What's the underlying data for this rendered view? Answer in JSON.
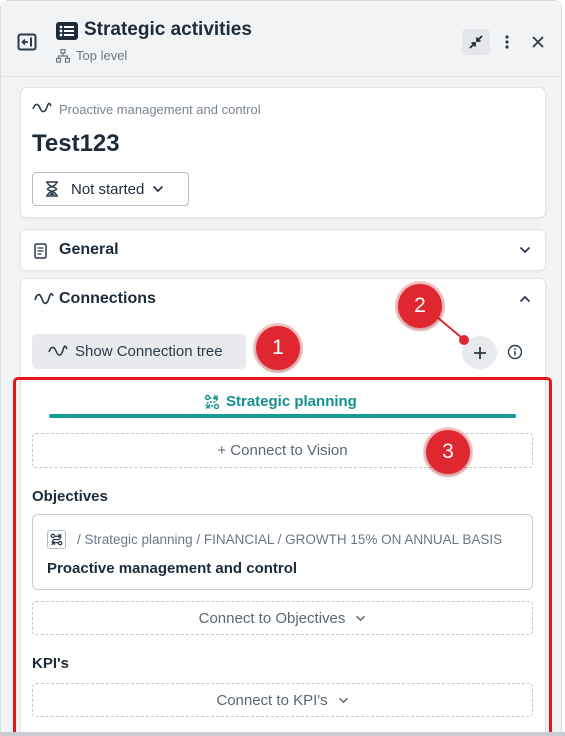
{
  "header": {
    "title": "Strategic activities",
    "subtitle": "Top level",
    "icons": [
      "collapse-panel-icon",
      "list-icon",
      "hierarchy-icon",
      "minimize-icon",
      "more-vertical-icon",
      "close-icon"
    ]
  },
  "item": {
    "breadcrumb": "Proactive management and control",
    "title": "Test123",
    "status": "Not started"
  },
  "sections": {
    "general": {
      "label": "General"
    },
    "connections": {
      "label": "Connections",
      "show_tree_label": "Show Connection tree",
      "strategic_planning_label": "Strategic planning",
      "connect_vision_label": "+ Connect to Vision",
      "objectives_heading": "Objectives",
      "objective": {
        "path": "/ Strategic planning / FINANCIAL / GROWTH 15% ON ANNUAL BASIS",
        "title": "Proactive management and control"
      },
      "connect_objectives_label": "Connect to Objectives",
      "kpis_heading": "KPI's",
      "connect_kpis_label": "Connect to KPI's"
    }
  },
  "callouts": [
    "1",
    "2",
    "3"
  ],
  "colors": {
    "accent_teal": "#169c98",
    "callout_red": "#e0262e",
    "highlight_frame": "#e3161c",
    "text_dark": "#1d2b3a"
  }
}
